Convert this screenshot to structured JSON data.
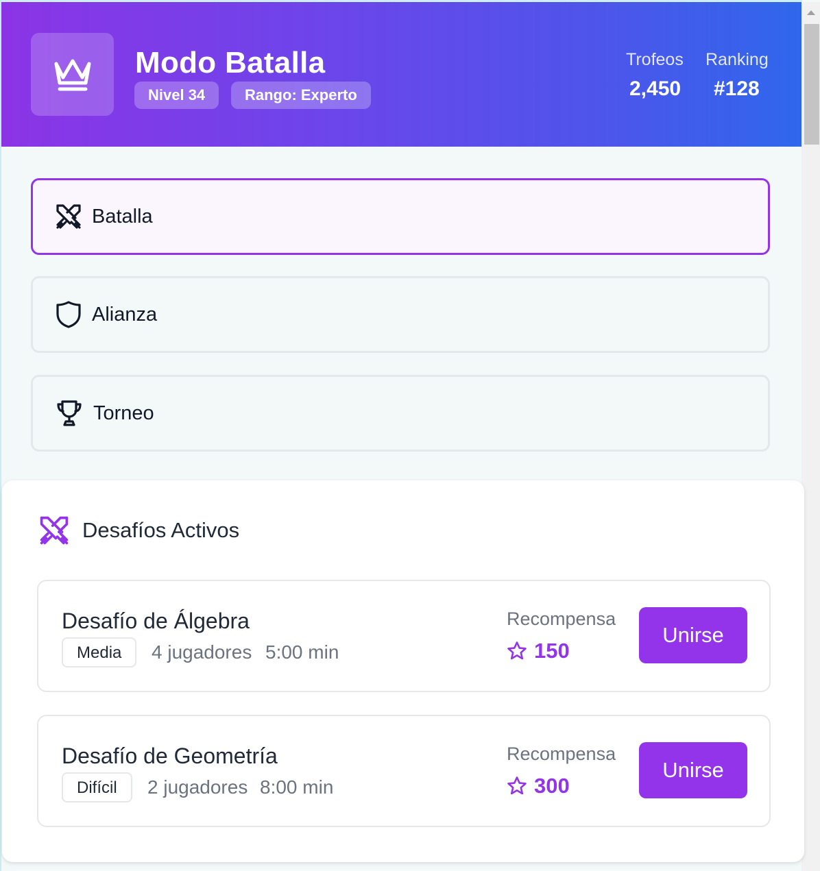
{
  "header": {
    "title": "Modo Batalla",
    "level": "Nivel 34",
    "rank": "Rango: Experto",
    "stats": [
      {
        "label": "Trofeos",
        "value": "2,450"
      },
      {
        "label": "Ranking",
        "value": "#128"
      }
    ],
    "icon": "crown-icon"
  },
  "modes": [
    {
      "label": "Batalla",
      "icon": "swords-icon",
      "active": true
    },
    {
      "label": "Alianza",
      "icon": "shield-icon",
      "active": false
    },
    {
      "label": "Torneo",
      "icon": "trophy-icon",
      "active": false
    }
  ],
  "challenges_section": {
    "title": "Desafíos Activos",
    "icon": "swords-icon",
    "items": [
      {
        "name": "Desafío de Álgebra",
        "difficulty": "Media",
        "players": "4 jugadores",
        "time": "5:00 min",
        "reward_label": "Recompensa",
        "reward": "150",
        "button": "Unirse"
      },
      {
        "name": "Desafío de Geometría",
        "difficulty": "Difícil",
        "players": "2 jugadores",
        "time": "8:00 min",
        "reward_label": "Recompensa",
        "reward": "300",
        "button": "Unirse"
      }
    ]
  },
  "colors": {
    "accent": "#9333ea",
    "gradient_start": "#8b34e6",
    "gradient_end": "#2f67ec"
  }
}
